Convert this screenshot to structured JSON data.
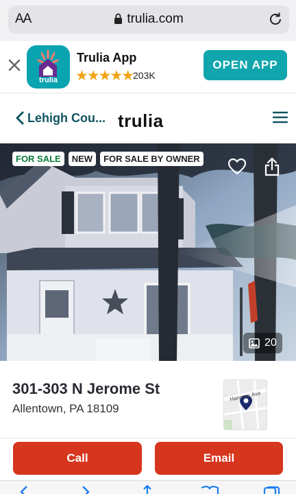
{
  "browser": {
    "aa_label": "AA",
    "domain": "trulia.com"
  },
  "app_banner": {
    "app_name": "Trulia App",
    "icon_word": "trulia",
    "rating_stars": "★★★★★",
    "rating_count": "203K",
    "open_label": "OPEN APP"
  },
  "header": {
    "back_label": "Lehigh Cou...",
    "logo": "trulia"
  },
  "listing": {
    "tags": [
      "FOR SALE",
      "NEW",
      "FOR SALE BY OWNER"
    ],
    "photo_count": "20",
    "address_line1": "301-303 N Jerome St",
    "address_line2": "Allentown, PA 18109",
    "map_street": "Hanover Ave"
  },
  "actions": {
    "call_label": "Call",
    "email_label": "Email"
  },
  "colors": {
    "accent_teal": "#11a6ae",
    "cta_red": "#d6351e",
    "nav_teal": "#0f5460",
    "star_orange": "#f1a416"
  }
}
